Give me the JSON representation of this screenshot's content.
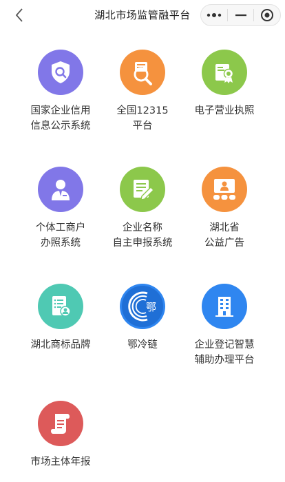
{
  "navbar": {
    "title": "湖北市场监管融平台",
    "back_icon": "chevron-left-icon",
    "more_icon": "more-dots-icon",
    "minimize_icon": "minimize-icon",
    "close_icon": "target-close-icon"
  },
  "colors": {
    "purple": "#8177e8",
    "orange": "#f5923e",
    "green": "#8cc84b",
    "teal": "#4fc9b3",
    "blue": "#2f86f0",
    "red": "#dd5a5a"
  },
  "services": [
    {
      "label": "国家企业信用\n信息公示系统",
      "icon": "shield-search-icon",
      "color": "#8177e8"
    },
    {
      "label": "全国12315\n平台",
      "icon": "magnifier-clipboard-icon",
      "color": "#f5923e"
    },
    {
      "label": "电子营业执照",
      "icon": "license-badge-icon",
      "color": "#8cc84b"
    },
    {
      "label": "个体工商户\n办照系统",
      "icon": "person-user-icon",
      "color": "#8177e8"
    },
    {
      "label": "企业名称\n自主申报系统",
      "icon": "document-pen-icon",
      "color": "#8cc84b"
    },
    {
      "label": "湖北省\n公益广告",
      "icon": "presentation-board-icon",
      "color": "#f5923e"
    },
    {
      "label": "湖北商标品牌",
      "icon": "trademark-document-icon",
      "color": "#4fc9b3"
    },
    {
      "label": "鄂冷链",
      "icon": "e-cold-chain-logo-icon",
      "color": "#2f86f0"
    },
    {
      "label": "企业登记智慧\n辅助办理平台",
      "icon": "office-building-icon",
      "color": "#2f86f0"
    },
    {
      "label": "市场主体年报",
      "icon": "scroll-report-icon",
      "color": "#dd5a5a"
    }
  ]
}
